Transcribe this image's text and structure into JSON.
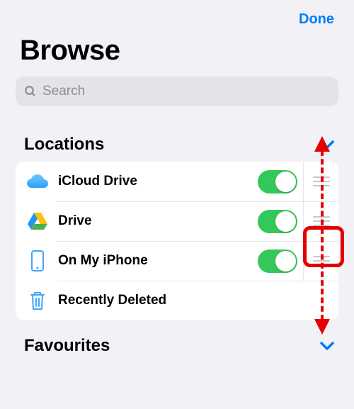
{
  "header": {
    "done": "Done"
  },
  "title": "Browse",
  "search": {
    "placeholder": "Search"
  },
  "sections": {
    "locations": {
      "label": "Locations",
      "items": [
        {
          "icon": "icloud",
          "label": "iCloud Drive",
          "toggle": true,
          "drag": true
        },
        {
          "icon": "gdrive",
          "label": "Drive",
          "toggle": true,
          "drag": true
        },
        {
          "icon": "iphone",
          "label": "On My iPhone",
          "toggle": true,
          "drag": true
        },
        {
          "icon": "trash",
          "label": "Recently Deleted",
          "toggle": false,
          "drag": false
        }
      ]
    },
    "favourites": {
      "label": "Favourites"
    }
  },
  "colors": {
    "accent": "#007aff",
    "toggle_on": "#34c759",
    "annotation": "#e30000"
  }
}
